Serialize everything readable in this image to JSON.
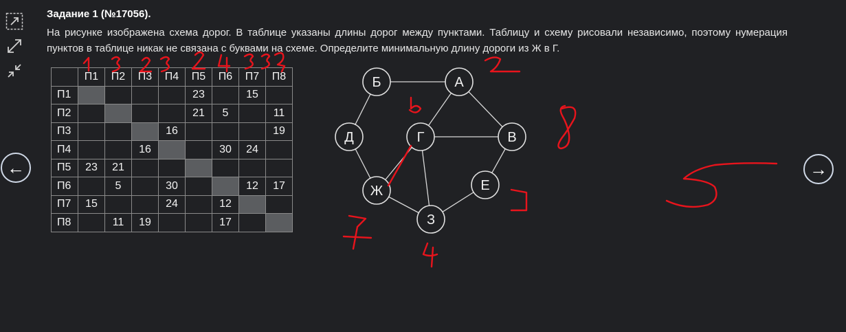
{
  "task": {
    "title": "Задание 1 (№17056).",
    "text": "На рисунке изображена схема дорог. В таблице указаны длины дорог между пунктами. Таблицу и схему рисовали независимо, поэтому нумерация пунктов в таблице никак не связана с буквами на схеме. Определите минимальную длину дороги из Ж в Г."
  },
  "navigation": {
    "prev_label": "←",
    "next_label": "→"
  },
  "toolbar": {
    "icons": [
      "expand-icon",
      "fullscreen-icon",
      "collapse-icon"
    ]
  },
  "table": {
    "headers": [
      "",
      "П1",
      "П2",
      "П3",
      "П4",
      "П5",
      "П6",
      "П7",
      "П8"
    ],
    "rows": [
      {
        "label": "П1",
        "cells": [
          "",
          "",
          "",
          "",
          "23",
          "",
          "15",
          ""
        ]
      },
      {
        "label": "П2",
        "cells": [
          "",
          "",
          "",
          "",
          "21",
          "5",
          "",
          "11"
        ]
      },
      {
        "label": "П3",
        "cells": [
          "",
          "",
          "",
          "16",
          "",
          "",
          "",
          "19"
        ]
      },
      {
        "label": "П4",
        "cells": [
          "",
          "",
          "16",
          "",
          "",
          "30",
          "24",
          ""
        ]
      },
      {
        "label": "П5",
        "cells": [
          "23",
          "21",
          "",
          "",
          "",
          "",
          "",
          ""
        ]
      },
      {
        "label": "П6",
        "cells": [
          "",
          "5",
          "",
          "30",
          "",
          "",
          "12",
          "17"
        ]
      },
      {
        "label": "П7",
        "cells": [
          "15",
          "",
          "",
          "24",
          "",
          "12",
          "",
          ""
        ]
      },
      {
        "label": "П8",
        "cells": [
          "",
          "11",
          "19",
          "",
          "",
          "17",
          "",
          ""
        ]
      }
    ]
  },
  "graph": {
    "nodes": [
      {
        "id": "B",
        "label": "Б"
      },
      {
        "id": "A",
        "label": "А"
      },
      {
        "id": "D",
        "label": "Д"
      },
      {
        "id": "G",
        "label": "Г"
      },
      {
        "id": "V",
        "label": "В"
      },
      {
        "id": "E",
        "label": "Е"
      },
      {
        "id": "ZH",
        "label": "Ж"
      },
      {
        "id": "Z",
        "label": "З"
      }
    ],
    "edges": [
      [
        "B",
        "A"
      ],
      [
        "B",
        "D"
      ],
      [
        "A",
        "G"
      ],
      [
        "A",
        "V"
      ],
      [
        "G",
        "V"
      ],
      [
        "D",
        "ZH"
      ],
      [
        "G",
        "ZH"
      ],
      [
        "G",
        "Z"
      ],
      [
        "ZH",
        "Z"
      ],
      [
        "Z",
        "E"
      ],
      [
        "E",
        "V"
      ]
    ]
  },
  "colors": {
    "background": "#202124",
    "node_stroke": "#e0e0e0",
    "diag_cell": "#5b5d60",
    "ink": "#e8141c"
  }
}
